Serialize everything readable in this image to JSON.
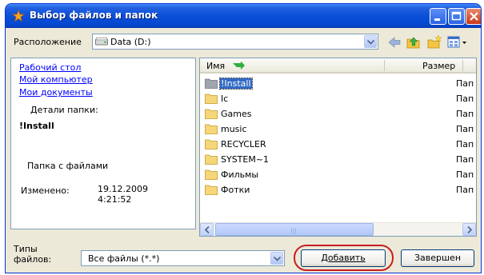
{
  "window": {
    "title": "Выбор файлов и папок"
  },
  "location": {
    "label": "Расположение",
    "value": "Data (D:)"
  },
  "toolbar": {
    "icons": [
      "back-icon",
      "up-folder-icon",
      "new-folder-icon",
      "view-menu-icon"
    ]
  },
  "left_pane": {
    "links": [
      "Рабочий стол",
      "Мой компьютер",
      "Мои документы"
    ],
    "details_label": "Детали папки:",
    "folder_name": "!Install",
    "folder_type": "Папка с файлами",
    "modified_label": "Изменено:",
    "modified_date": "19.12.2009",
    "modified_time": "4:21:52"
  },
  "file_list": {
    "columns": {
      "name": "Имя",
      "size": "Размер"
    },
    "rows": [
      {
        "name": "!Install",
        "type": "Пап",
        "selected": true
      },
      {
        "name": "Ic",
        "type": "Пап"
      },
      {
        "name": "Games",
        "type": "Пап"
      },
      {
        "name": "music",
        "type": "Пап"
      },
      {
        "name": "RECYCLER",
        "type": "Пап"
      },
      {
        "name": "SYSTEM~1",
        "type": "Пап"
      },
      {
        "name": "Фильмы",
        "type": "Пап"
      },
      {
        "name": "Фотки",
        "type": "Пап"
      }
    ]
  },
  "file_types": {
    "label": "Типы файлов:",
    "value": "Все файлы (*.*)"
  },
  "buttons": {
    "add": "Добавить",
    "finish": "Завершен"
  },
  "colors": {
    "title_bar": "#0a4fd8",
    "selection": "#316ac5",
    "highlight_ring": "#c81e1e"
  }
}
